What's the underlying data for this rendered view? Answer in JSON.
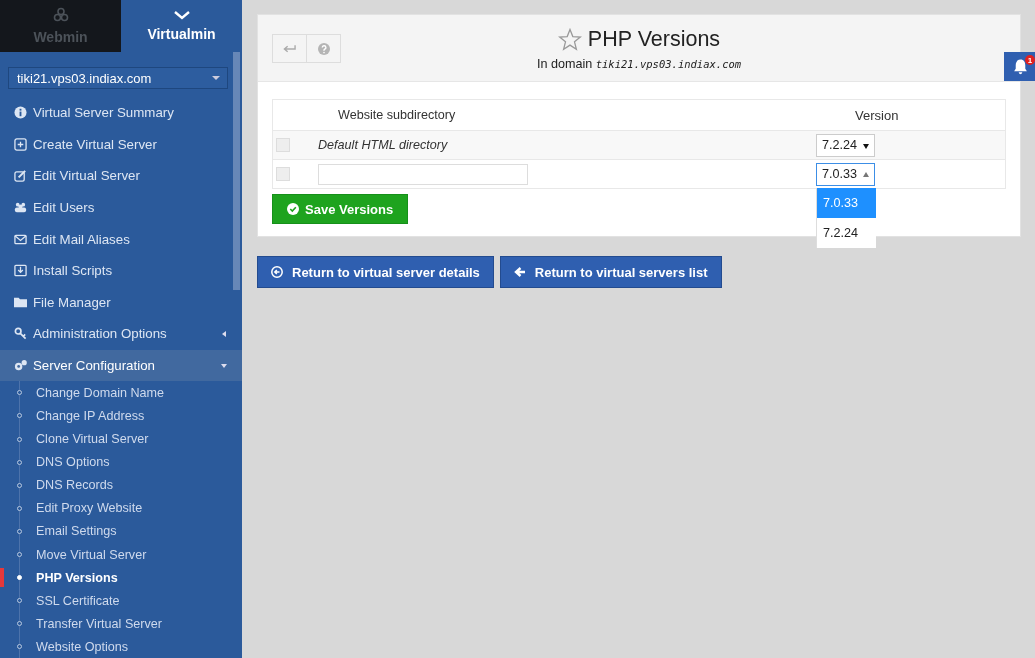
{
  "top_tabs": [
    {
      "label": "Webmin",
      "selected": false
    },
    {
      "label": "Virtualmin",
      "selected": true
    }
  ],
  "domain_select": {
    "value": "tiki21.vps03.indiax.com"
  },
  "menu": [
    {
      "label": "Virtual Server Summary"
    },
    {
      "label": "Create Virtual Server"
    },
    {
      "label": "Edit Virtual Server"
    },
    {
      "label": "Edit Users"
    },
    {
      "label": "Edit Mail Aliases"
    },
    {
      "label": "Install Scripts"
    },
    {
      "label": "File Manager"
    },
    {
      "label": "Administration Options",
      "expanded": false
    },
    {
      "label": "Server Configuration",
      "expanded": true,
      "children": [
        {
          "label": "Change Domain Name",
          "selected": false
        },
        {
          "label": "Change IP Address",
          "selected": false
        },
        {
          "label": "Clone Virtual Server",
          "selected": false
        },
        {
          "label": "DNS Options",
          "selected": false
        },
        {
          "label": "DNS Records",
          "selected": false
        },
        {
          "label": "Edit Proxy Website",
          "selected": false
        },
        {
          "label": "Email Settings",
          "selected": false
        },
        {
          "label": "Move Virtual Server",
          "selected": false
        },
        {
          "label": "PHP Versions",
          "selected": true
        },
        {
          "label": "SSL Certificate",
          "selected": false
        },
        {
          "label": "Transfer Virtual Server",
          "selected": false
        },
        {
          "label": "Website Options",
          "selected": false
        }
      ]
    }
  ],
  "page": {
    "title": "PHP Versions",
    "subtitle": "In domain",
    "domain": "tiki21.vps03.indiax.com"
  },
  "notifications": {
    "count": "1"
  },
  "table": {
    "columns": [
      "Website subdirectory",
      "Version"
    ],
    "rows": [
      {
        "kind": "default",
        "checked": false,
        "directory": "Default HTML directory",
        "version": "7.2.24",
        "open": false
      },
      {
        "kind": "input",
        "checked": false,
        "version": "7.0.33",
        "open": true,
        "options": [
          {
            "label": "7.0.33",
            "selected": true
          },
          {
            "label": "7.2.24",
            "selected": false
          }
        ]
      }
    ]
  },
  "save_button": "Save Versions",
  "buttons": [
    {
      "label": "Return to virtual server details"
    },
    {
      "label": "Return to virtual servers list"
    }
  ]
}
